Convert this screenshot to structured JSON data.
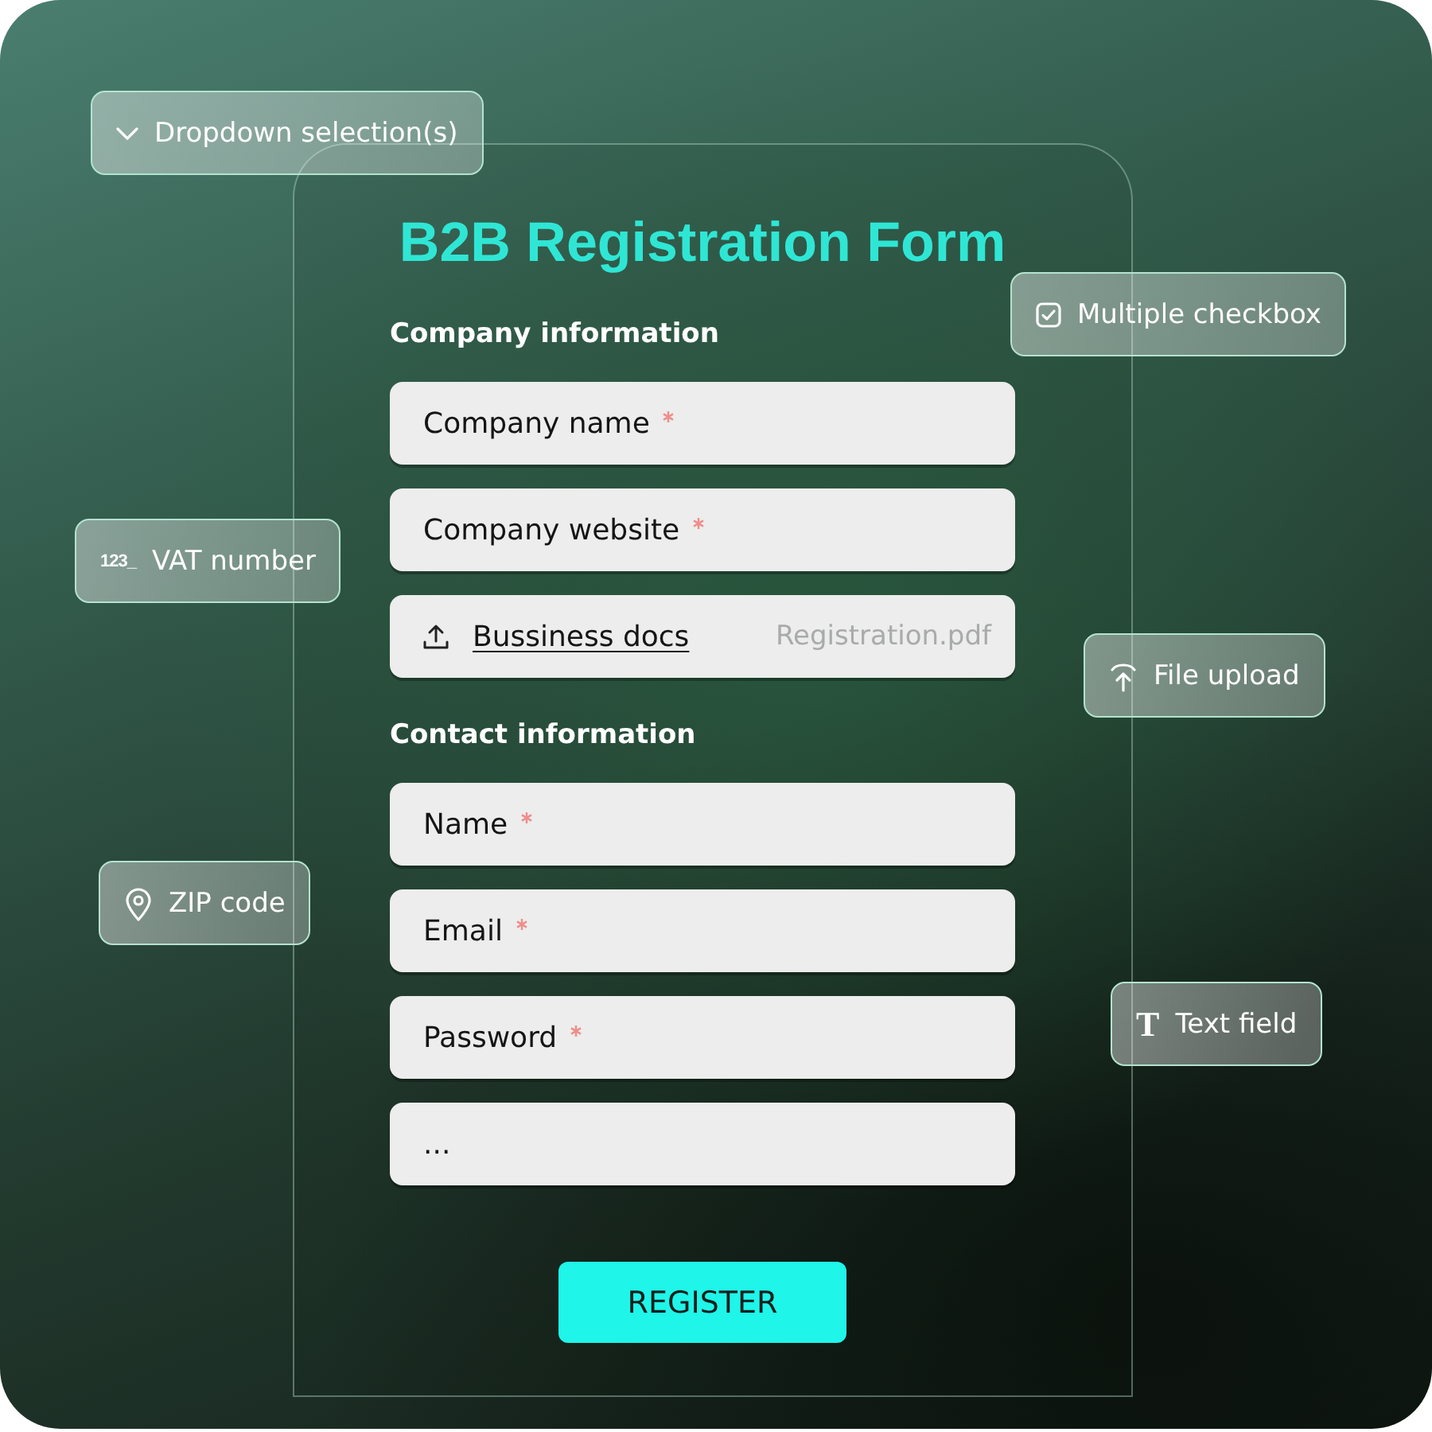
{
  "form": {
    "title": "B2B Registration Form",
    "sections": [
      {
        "heading": "Company information",
        "fields": [
          {
            "kind": "text",
            "label": "Company name",
            "required": true
          },
          {
            "kind": "text",
            "label": "Company website",
            "required": true
          },
          {
            "kind": "upload",
            "link": "Bussiness docs",
            "file": "Registration.pdf"
          }
        ]
      },
      {
        "heading": "Contact information",
        "fields": [
          {
            "kind": "text",
            "label": "Name",
            "required": true
          },
          {
            "kind": "text",
            "label": "Email",
            "required": true
          },
          {
            "kind": "text",
            "label": "Password",
            "required": true
          },
          {
            "kind": "text",
            "label": "...",
            "required": false
          }
        ]
      }
    ],
    "submit": {
      "label": "REGISTER"
    }
  },
  "tags": [
    {
      "kind": "dropdown",
      "label": "Dropdown selection(s)"
    },
    {
      "kind": "checkbox",
      "label": "Multiple checkbox"
    },
    {
      "kind": "number",
      "glyph": "123_",
      "label": "VAT number"
    },
    {
      "kind": "upload",
      "label": "File upload"
    },
    {
      "kind": "location",
      "label": "ZIP code"
    },
    {
      "kind": "text",
      "glyph": "T",
      "label": "Text field"
    }
  ]
}
